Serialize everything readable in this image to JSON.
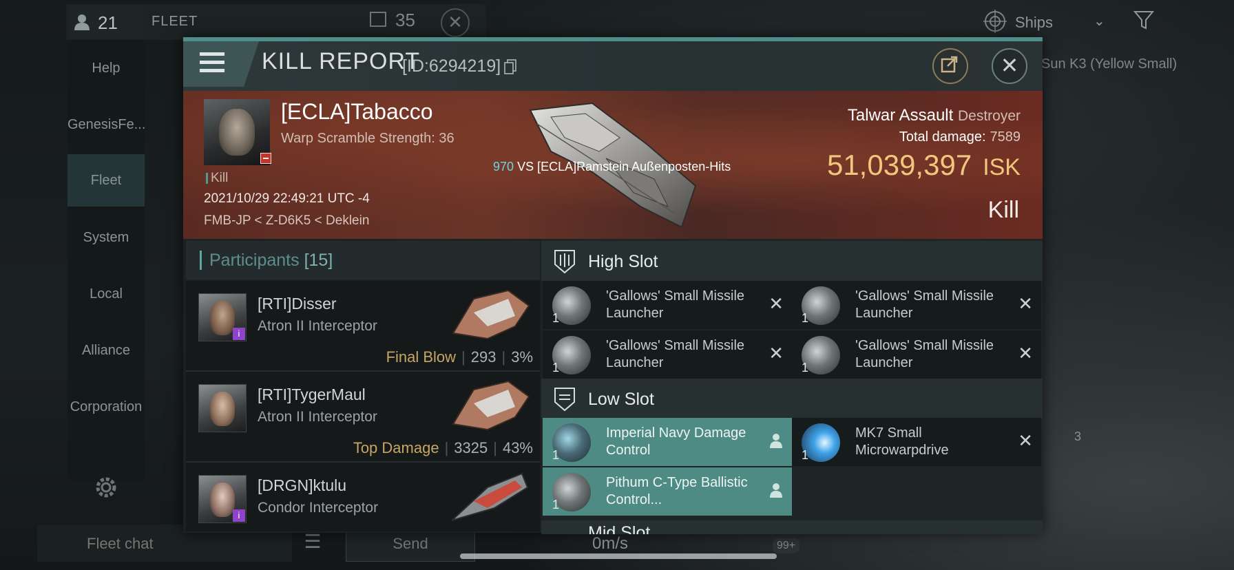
{
  "background": {
    "fleet_members": "21",
    "fleet_title": "FLEET",
    "chat_count": "35",
    "ships_filter_label": "Ships",
    "system_name": "Sun K3 (Yellow Small)",
    "sidenav": [
      "Help",
      "GenesisFe...",
      "Fleet",
      "System",
      "Local",
      "Alliance",
      "Corporation"
    ],
    "chat_placeholder": "Fleet chat",
    "send_label": "Send",
    "speed": "0m/s",
    "notif": "99+",
    "object_badge": "3"
  },
  "dialog": {
    "title": "KILL REPORT",
    "kill_id": "[ID:6294219]",
    "victim": {
      "name": "[ECLA]Tabacco",
      "warp_scramble": "Warp Scramble Strength: 36",
      "kill_tag": "Kill",
      "timestamp": "2021/10/29 22:49:21 UTC -4",
      "location": "FMB-JP < Z-D6K5 < Deklein"
    },
    "vs": {
      "number": "970",
      "text": "VS [ECLA]Ramstein Außenposten-Hits"
    },
    "ship": {
      "name": "Talwar Assault",
      "class": "Destroyer",
      "total_damage_label": "Total damage:",
      "total_damage": "7589",
      "isk_value": "51,039,397",
      "isk_unit": "ISK",
      "result": "Kill"
    },
    "participants": {
      "label": "Participants",
      "count": "[15]",
      "rows": [
        {
          "name": "[RTI]Disser",
          "ship": "Atron II Interceptor",
          "tag": "Final Blow",
          "damage": "293",
          "percent": "3%",
          "badge": "i"
        },
        {
          "name": "[RTI]TygerMaul",
          "ship": "Atron II Interceptor",
          "tag": "Top Damage",
          "damage": "3325",
          "percent": "43%",
          "badge": ""
        },
        {
          "name": "[DRGN]ktulu",
          "ship": "Condor Interceptor",
          "tag": "",
          "damage": "",
          "percent": "",
          "badge": "i"
        }
      ]
    },
    "fitting": {
      "high_slot_label": "High Slot",
      "low_slot_label": "Low Slot",
      "high_slots": [
        {
          "name": "'Gallows' Small Missile Launcher",
          "qty": "1"
        },
        {
          "name": "'Gallows' Small Missile Launcher",
          "qty": "1"
        },
        {
          "name": "'Gallows' Small Missile Launcher",
          "qty": "1"
        },
        {
          "name": "'Gallows' Small Missile Launcher",
          "qty": "1"
        }
      ],
      "low_slots": [
        {
          "name": "Imperial Navy Damage Control",
          "qty": "1",
          "dropped": true
        },
        {
          "name": "MK7 Small Microwarpdrive",
          "qty": "1",
          "dropped": false
        },
        {
          "name": "Pithum C-Type Ballistic Control...",
          "qty": "1",
          "dropped": true
        }
      ],
      "next_slot_label": "Mid Slot"
    }
  },
  "colors": {
    "accent_teal": "#4f8c8a",
    "isk_gold": "#f0c77d",
    "dropped_green": "#4d8b84",
    "tag_gold": "#c6a664",
    "vs_cyan": "#66d6e4"
  }
}
